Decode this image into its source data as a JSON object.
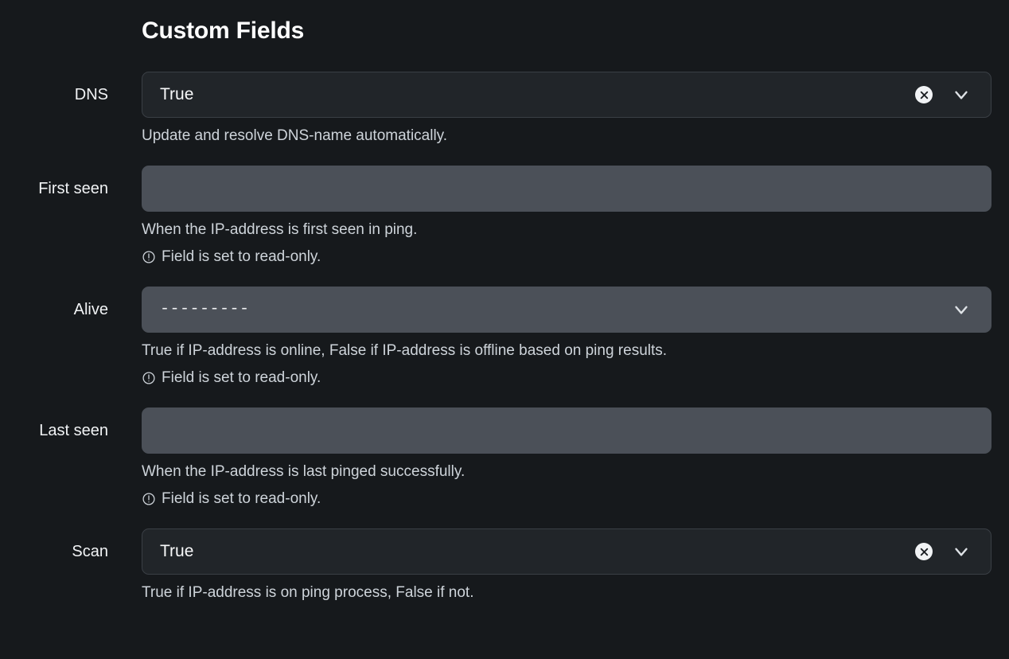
{
  "section": {
    "title": "Custom Fields"
  },
  "colors": {
    "page_background": "#16191c",
    "input_background": "#212529",
    "input_border": "#3a3f45",
    "disabled_background": "#4b5058",
    "label_text": "#f1f3f5",
    "help_text": "#ced4da",
    "value_text": "#f8f9fa",
    "clear_icon_circle": "#f1f3f5",
    "clear_icon_glyph": "#212529"
  },
  "fields": [
    {
      "label": "DNS",
      "value": "True",
      "disabled": false,
      "has_clear": true,
      "has_chevron": true,
      "clear_icon": "clear-circle-x-icon",
      "chevron_icon": "chevron-down-icon",
      "help": "Update and resolve DNS-name automatically.",
      "readonly_note": null
    },
    {
      "label": "First seen",
      "value": "",
      "disabled": true,
      "has_clear": false,
      "has_chevron": false,
      "clear_icon": null,
      "chevron_icon": null,
      "help": "When the IP-address is first seen in ping.",
      "readonly_note": "Field is set to read-only.",
      "readonly_icon": "exclamation-circle-icon"
    },
    {
      "label": "Alive",
      "value": "---------",
      "disabled": true,
      "has_clear": false,
      "has_chevron": true,
      "clear_icon": null,
      "chevron_icon": "chevron-down-icon",
      "help": "True if IP-address is online, False if IP-address is offline based on ping results.",
      "readonly_note": "Field is set to read-only.",
      "readonly_icon": "exclamation-circle-icon"
    },
    {
      "label": "Last seen",
      "value": "",
      "disabled": true,
      "has_clear": false,
      "has_chevron": false,
      "clear_icon": null,
      "chevron_icon": null,
      "help": "When the IP-address is last pinged successfully.",
      "readonly_note": "Field is set to read-only.",
      "readonly_icon": "exclamation-circle-icon"
    },
    {
      "label": "Scan",
      "value": "True",
      "disabled": false,
      "has_clear": true,
      "has_chevron": true,
      "clear_icon": "clear-circle-x-icon",
      "chevron_icon": "chevron-down-icon",
      "help": "True if IP-address is on ping process, False if not.",
      "readonly_note": null
    }
  ]
}
